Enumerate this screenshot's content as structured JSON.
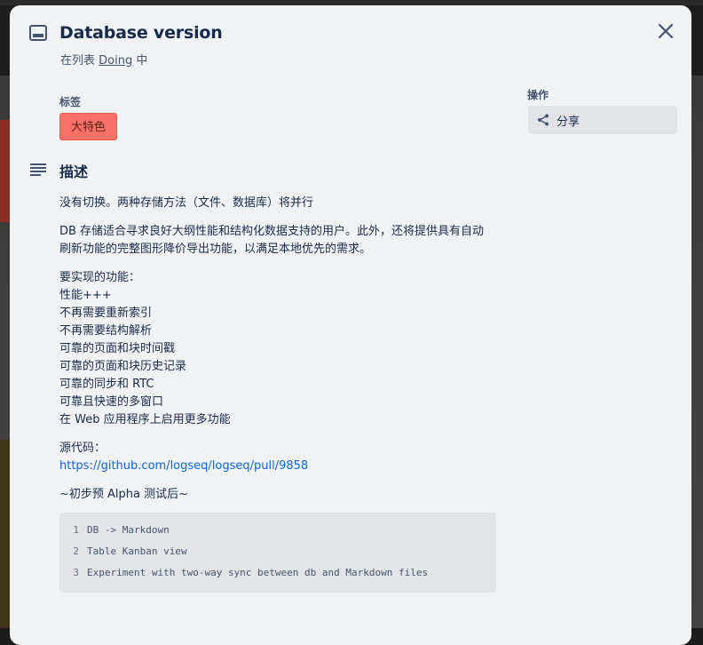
{
  "card": {
    "title": "Database version",
    "in_list_prefix": "在列表",
    "list_name": "Doing",
    "in_list_suffix": "中"
  },
  "labels": {
    "heading": "标签",
    "items": [
      "大特色"
    ],
    "label_color": "#f87168"
  },
  "description": {
    "heading": "描述",
    "p1": "没有切换。两种存储方法（文件、数据库）将并行",
    "p2_line1": "DB 存储适合寻求良好大纲性能和结构化数据支持的用户。此外，还将提供具有自动",
    "p2_line2": "刷新功能的完整图形降价导出功能，以满足本地优先的需求。",
    "features_heading": "要实现的功能：",
    "features": [
      "性能+++",
      "不再需要重新索引",
      "不再需要结构解析",
      "可靠的页面和块时间戳",
      "可靠的页面和块历史记录",
      "可靠的同步和 RTC",
      "可靠且快速的多窗口",
      "在 Web 应用程序上启用更多功能"
    ],
    "source_heading": "源代码：",
    "source_link": "https://github.com/logseq/logseq/pull/9858",
    "after_alpha": "~初步预 Alpha 测试后~",
    "code_lines": [
      {
        "n": "1",
        "text": "DB -> Markdown"
      },
      {
        "n": "2",
        "text": "Table Kanban view"
      },
      {
        "n": "3",
        "text": "Experiment with two-way sync between db and Markdown files"
      }
    ]
  },
  "actions": {
    "heading": "操作",
    "share_label": "分享"
  },
  "icons": {
    "card": "card-icon",
    "close": "close-icon",
    "description": "description-icon",
    "share": "share-icon"
  },
  "colors": {
    "modal_bg": "#f1f2f4",
    "link": "#0c66e4",
    "text": "#172b4d"
  }
}
